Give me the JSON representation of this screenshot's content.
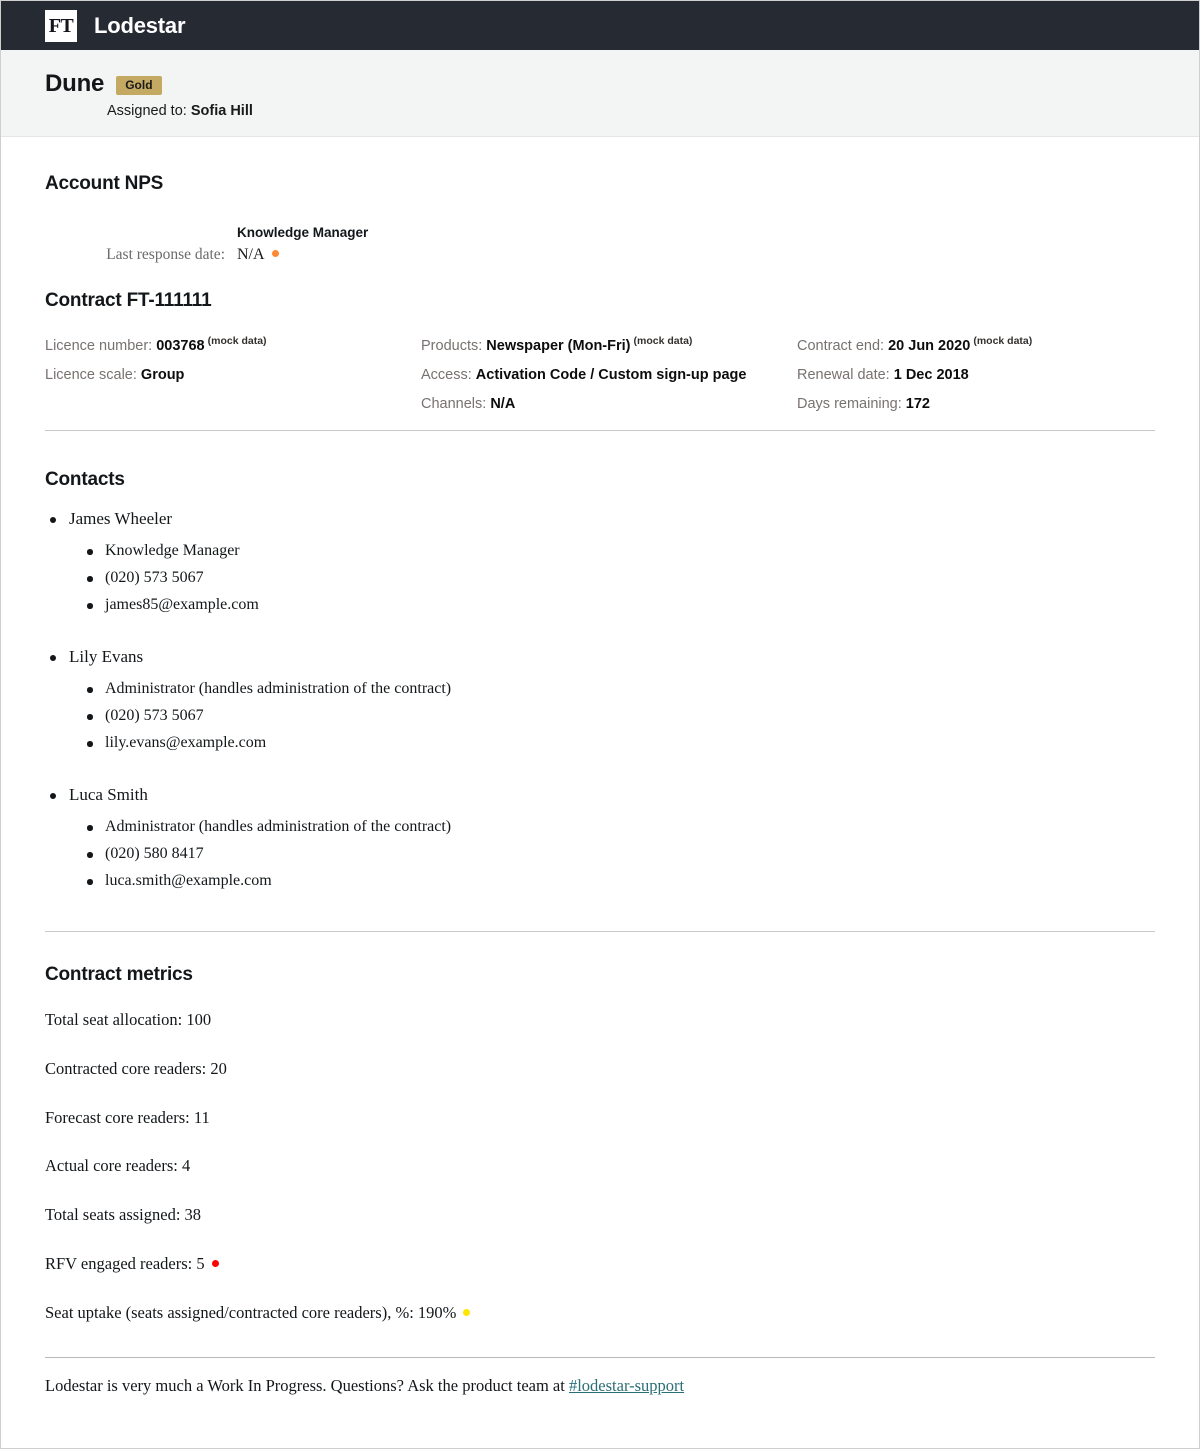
{
  "header": {
    "logo_text": "FT",
    "app_name": "Lodestar"
  },
  "account": {
    "name": "Dune",
    "tier_badge": "Gold",
    "assigned_label": "Assigned to:",
    "assigned_to": "Sofia Hill"
  },
  "nps": {
    "section_title": "Account NPS",
    "column_header": "Knowledge Manager",
    "row_label": "Last response date:",
    "row_value": "N/A",
    "status_color": "#ff8833"
  },
  "contract": {
    "section_title": "Contract FT-111111",
    "mock_tag": "(mock data)",
    "columns": [
      {
        "lines": [
          {
            "label": "Licence number:",
            "value": "003768",
            "mock": true
          },
          {
            "label": "Licence scale:",
            "value": "Group",
            "mock": false
          }
        ]
      },
      {
        "lines": [
          {
            "label": "Products:",
            "value": "Newspaper (Mon-Fri)",
            "mock": true
          },
          {
            "label": "Access:",
            "value": "Activation Code / Custom sign-up page",
            "mock": false
          },
          {
            "label": "Channels:",
            "value": "N/A",
            "mock": false
          }
        ]
      },
      {
        "lines": [
          {
            "label": "Contract end:",
            "value": "20 Jun 2020",
            "mock": true
          },
          {
            "label": "Renewal date:",
            "value": "1 Dec 2018",
            "mock": false
          },
          {
            "label": "Days remaining:",
            "value": "172",
            "mock": false
          }
        ]
      }
    ]
  },
  "contacts": {
    "section_title": "Contacts",
    "people": [
      {
        "name": "James Wheeler",
        "details": [
          "Knowledge Manager",
          " (020) 573 5067",
          "james85@example.com"
        ]
      },
      {
        "name": "Lily Evans",
        "details": [
          "Administrator (handles administration of the contract)",
          " (020) 573 5067",
          "lily.evans@example.com"
        ]
      },
      {
        "name": "Luca Smith",
        "details": [
          "Administrator (handles administration of the contract)",
          " (020) 580 8417",
          "luca.smith@example.com"
        ]
      }
    ]
  },
  "metrics": {
    "section_title": "Contract metrics",
    "items": [
      {
        "text": "Total seat allocation: 100",
        "status_color": null
      },
      {
        "text": "Contracted core readers: 20",
        "status_color": null
      },
      {
        "text": "Forecast core readers: 11",
        "status_color": null
      },
      {
        "text": "Actual core readers: 4",
        "status_color": null
      },
      {
        "text": "Total seats assigned: 38",
        "status_color": null
      },
      {
        "text": "RFV engaged readers: 5",
        "status_color": "#ff0000"
      },
      {
        "text": "Seat uptake (seats assigned/contracted core readers), %: 190%",
        "status_color": "#ffe600"
      }
    ]
  },
  "footer": {
    "text_before": "Lodestar is very much a Work In Progress. Questions? Ask the product team at ",
    "link_text": "#lodestar-support"
  }
}
